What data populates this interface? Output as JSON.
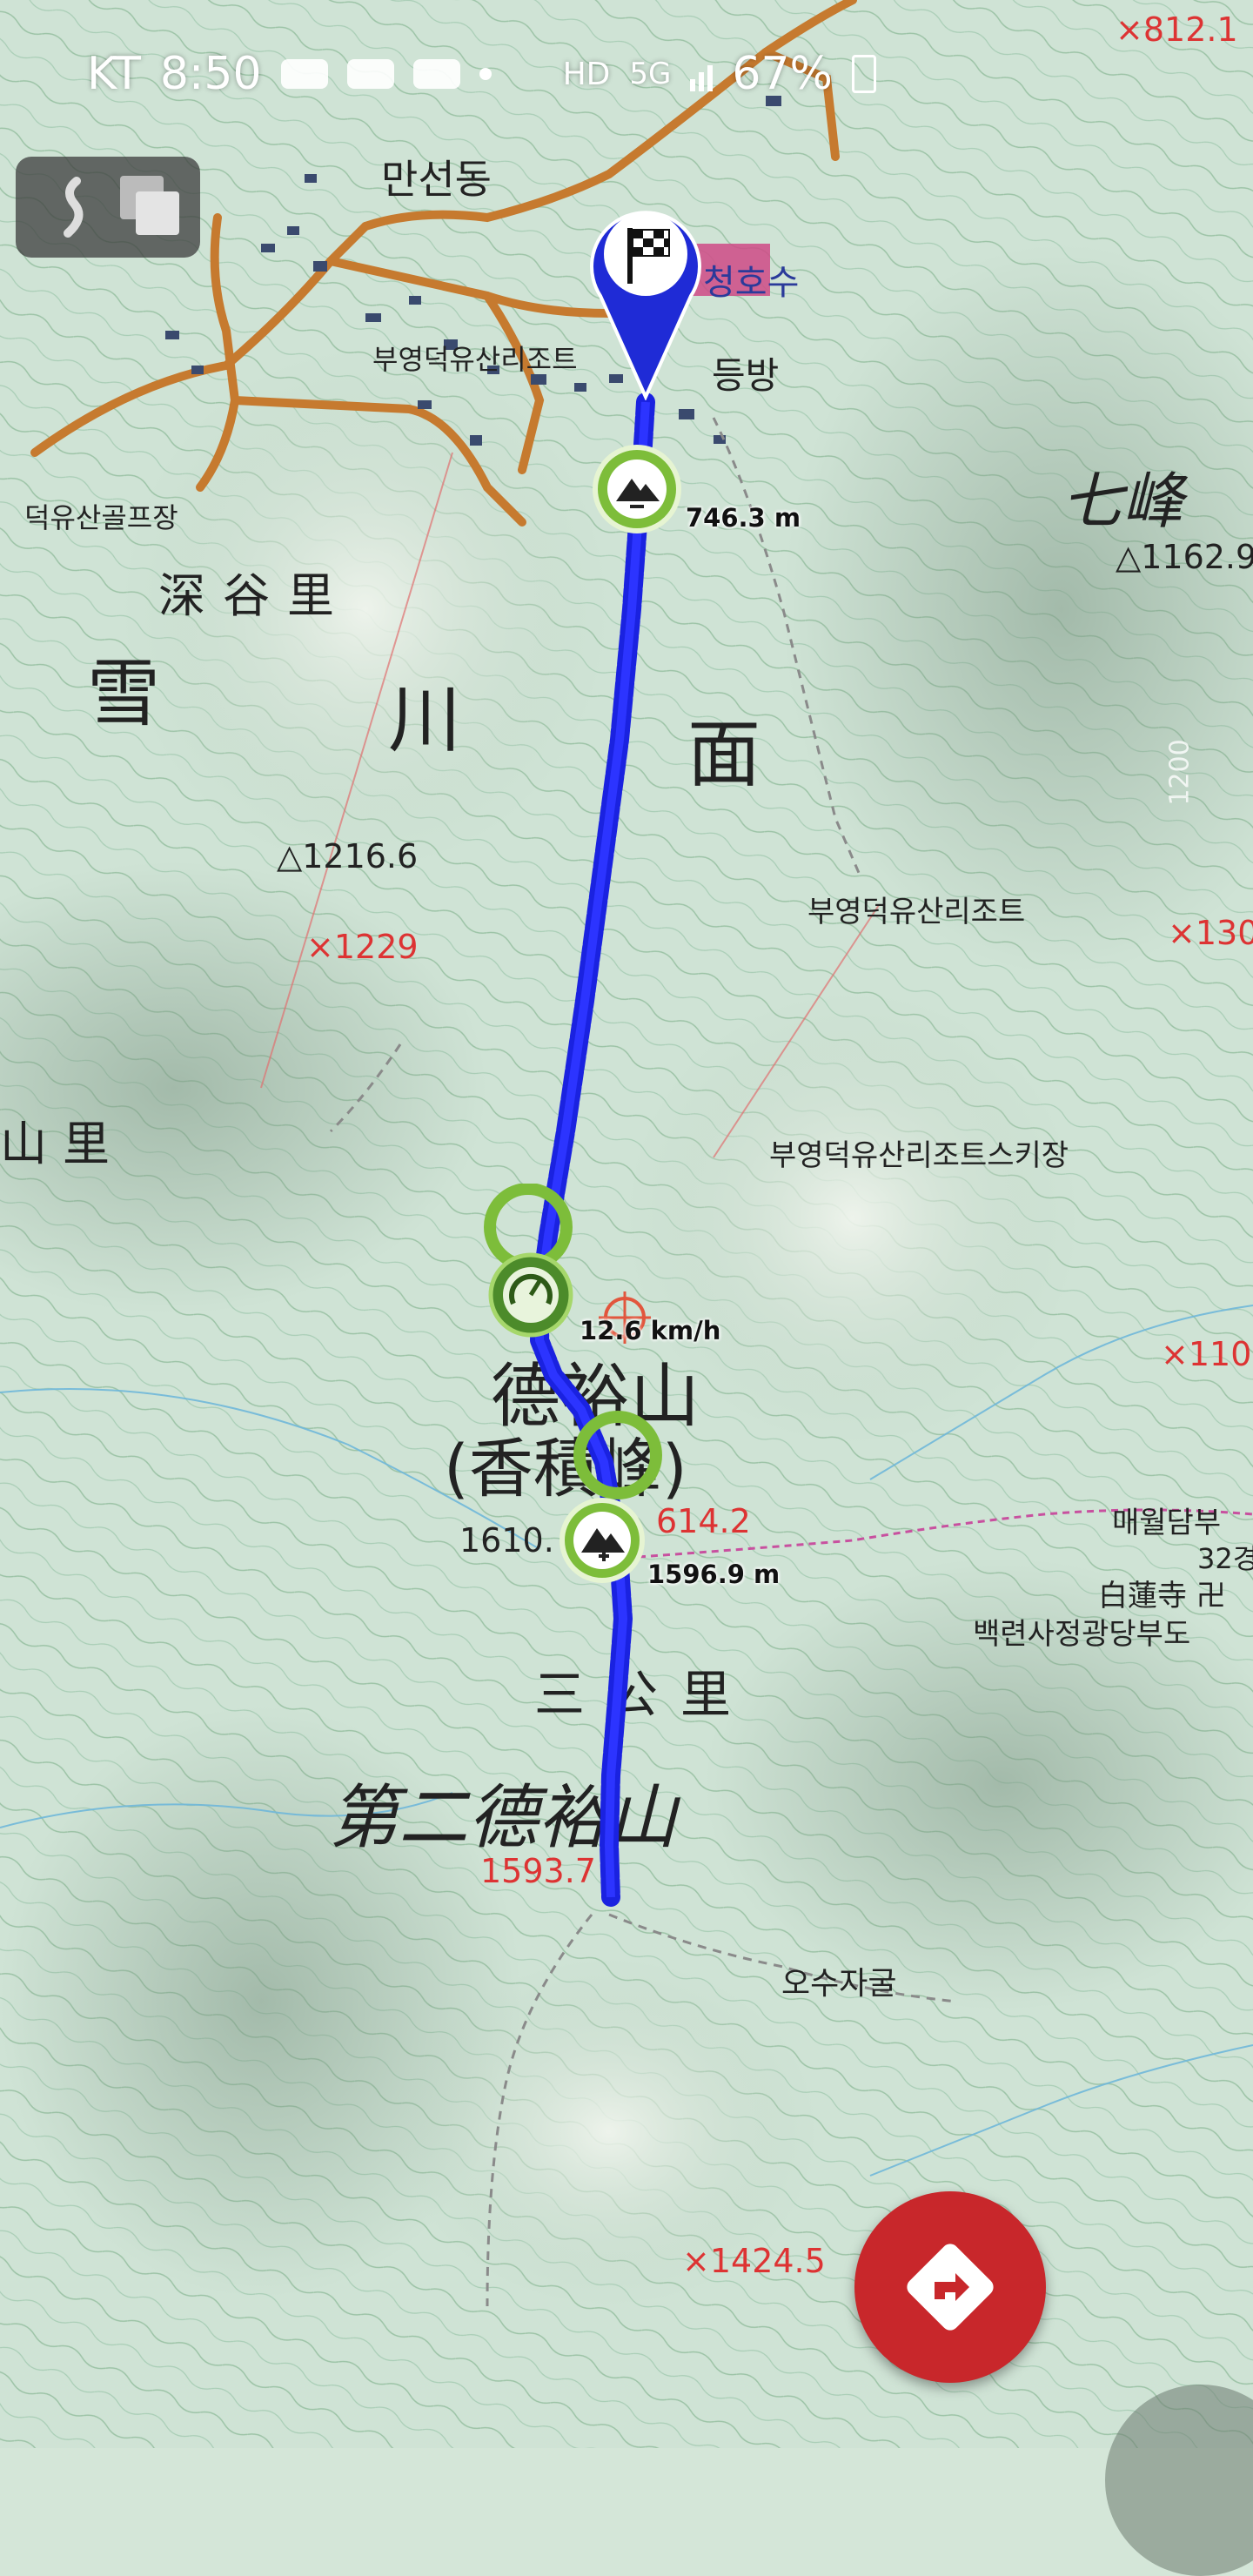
{
  "status_bar": {
    "carrier": "KT",
    "time": "8:50",
    "battery": "67%"
  },
  "map": {
    "village_labels": [
      {
        "text": "만선동"
      },
      {
        "text": "부영덕유산리조트"
      },
      {
        "text": "등방"
      },
      {
        "text": "덕유산골프장"
      },
      {
        "text": "부영덕유산리조트"
      },
      {
        "text": "부영덕유산리조트스키장"
      },
      {
        "text": "매월담부"
      },
      {
        "text": "32경"
      },
      {
        "text": "白蓮寺 卍"
      },
      {
        "text": "백련사정광당부도"
      },
      {
        "text": "오수자굴"
      }
    ],
    "area_labels": [
      {
        "text": "深谷里"
      },
      {
        "text": "雪"
      },
      {
        "text": "川"
      },
      {
        "text": "面"
      },
      {
        "text": "七峰"
      },
      {
        "text": "山里"
      },
      {
        "text": "德裕山"
      },
      {
        "text": "(香積峰)"
      },
      {
        "text": "三公里"
      },
      {
        "text": "第二德裕山"
      }
    ],
    "elevations_black": [
      {
        "text": "△1162.9"
      },
      {
        "text": "△1216.6"
      },
      {
        "text": "1610."
      }
    ],
    "elevations_red": [
      {
        "text": "×812.1"
      },
      {
        "text": "×1229"
      },
      {
        "text": "×130"
      },
      {
        "text": "×110"
      },
      {
        "text": "614.2"
      },
      {
        "text": "1593.7"
      },
      {
        "text": "×1424.5"
      }
    ],
    "pond_label": "청호수",
    "contour_label": "1200"
  },
  "track": {
    "min_elevation_label": "746.3 m",
    "max_elevation_label": "1596.9 m",
    "max_speed_label": "12.6 km/h"
  },
  "icons": {
    "finish": "checkered-flag-icon",
    "min_elev": "mountain-minus-icon",
    "max_elev": "mountain-plus-icon",
    "speed": "speedometer-icon",
    "layers": "map-layers-icon",
    "route": "directions-icon"
  },
  "colors": {
    "track": "#1a22e0",
    "marker_green": "#6aab2e",
    "fab_red": "#c8272b",
    "flag_blue": "#1f2bd6"
  }
}
